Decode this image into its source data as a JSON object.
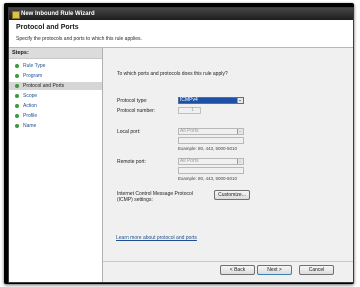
{
  "window": {
    "title": "New Inbound Rule Wizard",
    "icon": "wizard-icon"
  },
  "header": {
    "title": "Protocol and Ports",
    "subtitle": "Specify the protocols and ports to which this rule applies."
  },
  "steps": {
    "heading": "Steps:",
    "items": [
      {
        "label": "Rule Type"
      },
      {
        "label": "Program"
      },
      {
        "label": "Protocol and Ports"
      },
      {
        "label": "Scope"
      },
      {
        "label": "Action"
      },
      {
        "label": "Profile"
      },
      {
        "label": "Name"
      }
    ],
    "active_index": 2,
    "bullet_color": "#3c9a3c"
  },
  "main": {
    "question": "To which ports and protocols does this rule apply?",
    "protocol_type": {
      "label": "Protocol type:",
      "value": "ICMPv4"
    },
    "protocol_number": {
      "label": "Protocol number:",
      "value": "1"
    },
    "local_port": {
      "label": "Local port:",
      "value": "All Ports",
      "input": "",
      "example": "Example: 80, 443, 5000-5010"
    },
    "remote_port": {
      "label": "Remote port:",
      "value": "All Ports",
      "input": "",
      "example": "Example: 80, 443, 5000-5010"
    },
    "icmp": {
      "label_line1": "Internet Control Message Protocol",
      "label_line2": "(ICMP) settings:",
      "button": "Customize..."
    },
    "learn_more": "Learn more about protocol and ports"
  },
  "buttons": {
    "back": "< Back",
    "next": "Next >",
    "cancel": "Cancel"
  },
  "colors": {
    "titlebar": "#1d1d1d",
    "selection": "#1e50a8",
    "link": "#1f4e91"
  }
}
